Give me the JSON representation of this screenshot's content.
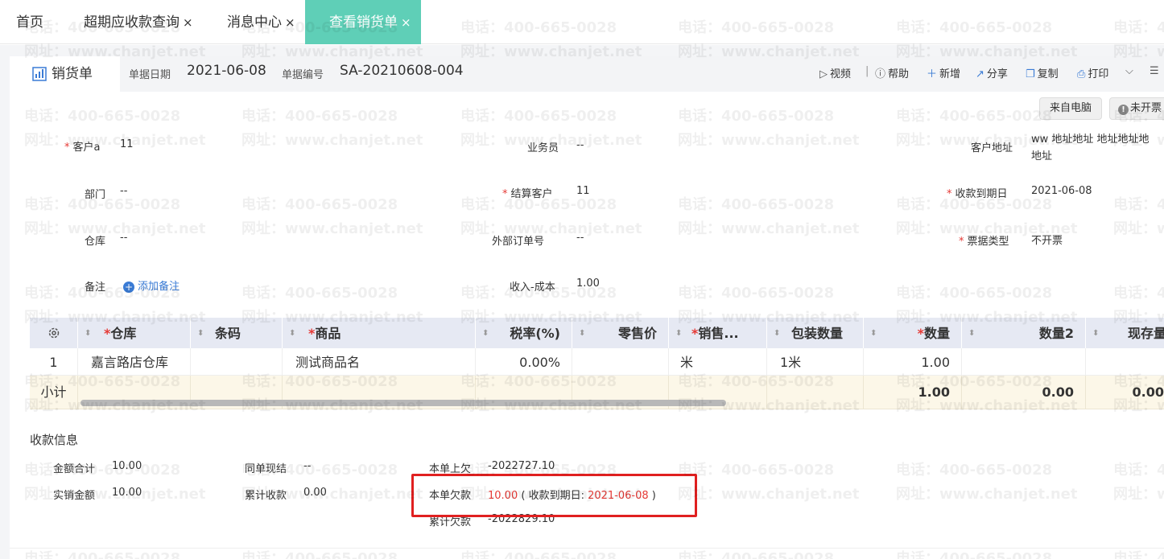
{
  "tabs": [
    {
      "label": "首页",
      "closable": false
    },
    {
      "label": "超期应收款查询",
      "closable": true
    },
    {
      "label": "消息中心",
      "closable": true
    },
    {
      "label": "查看销货单",
      "closable": true,
      "active": true
    }
  ],
  "close_glyph": "×",
  "accent_color": "#5fcfb7",
  "doc": {
    "tab_label": "销货单",
    "date_label": "单据日期",
    "date_value": "2021-06-08",
    "number_label": "单据编号",
    "number_value": "SA-20210608-004"
  },
  "toolbar": {
    "video": "视频",
    "sep": "|",
    "help": "帮助",
    "add": "新增",
    "share": "分享",
    "copy": "复制",
    "print": "打印"
  },
  "badges": {
    "source": "来自电脑",
    "invoice_status": "未开票"
  },
  "form": {
    "customer_label": "客户a",
    "customer_value": "11",
    "salesman_label": "业务员",
    "salesman_value": "--",
    "address_label": "客户地址",
    "address_value_line1": "ww 地址地址 地址地址地",
    "address_value_line2": "地址",
    "dept_label": "部门",
    "dept_value": "--",
    "settle_label": "结算客户",
    "settle_value": "11",
    "due_label": "收款到期日",
    "due_value": "2021-06-08",
    "warehouse_label": "仓库",
    "warehouse_value": "--",
    "ext_order_label": "外部订单号",
    "ext_order_value": "--",
    "invoice_type_label": "票据类型",
    "invoice_type_value": "不开票",
    "note_label": "备注",
    "add_note": "添加备注",
    "income_cost_label": "收入-成本",
    "income_cost_value": "1.00"
  },
  "table": {
    "headers": {
      "warehouse": "仓库",
      "barcode": "条码",
      "product": "商品",
      "tax_rate": "税率(%)",
      "retail_price": "零售价",
      "sales_unit": "销售...",
      "pack_qty": "包装数量",
      "qty": "数量",
      "qty2": "数量2",
      "stock": "现存量"
    },
    "row": {
      "index": "1",
      "warehouse": "嘉言路店仓库",
      "product": "测试商品名",
      "tax_rate": "0.00%",
      "sales_unit": "米",
      "pack_qty": "1米",
      "qty": "1.00"
    },
    "subtotal": {
      "label": "小计",
      "qty": "1.00",
      "qty2": "0.00",
      "stock": "0.00"
    }
  },
  "payment": {
    "title": "收款信息",
    "total_label": "金额合计",
    "total_value": "10.00",
    "actual_label": "实销金额",
    "actual_value": "10.00",
    "same_settle_label": "同单现结",
    "same_settle_value": "--",
    "cumulative_label": "累计收款",
    "cumulative_value": "0.00",
    "prev_owe_label": "本单上欠",
    "prev_owe_value": "-2022727.10",
    "owe_label": "本单欠款",
    "owe_value": "10.00",
    "owe_due_prefix": "( 收款到期日:",
    "owe_due_value": "2021-06-08",
    "owe_due_suffix": ")",
    "acc_owe_label": "累计欠款",
    "acc_owe_value": "-2022829.10"
  },
  "watermark": {
    "phone": "电话：400-665-0028",
    "site": "网址：www.chanjet.net"
  }
}
